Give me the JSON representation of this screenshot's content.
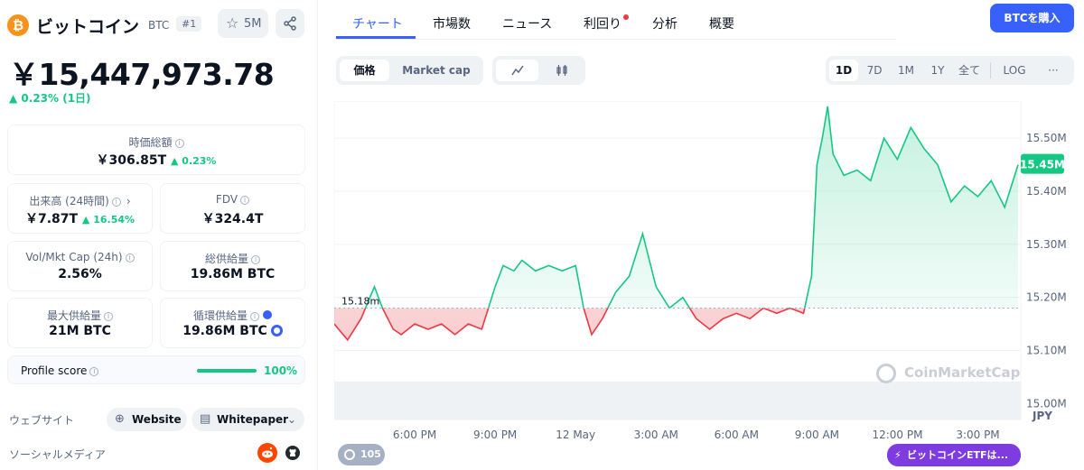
{
  "coin": {
    "logo_glyph": "₿",
    "name": "ビットコイン",
    "symbol": "BTC",
    "rank": "#1",
    "watchlist_count": "5M",
    "price": "￥15,447,973.78",
    "change": "▲ 0.23% (1日)"
  },
  "stats": {
    "market_cap": {
      "label": "時価総額",
      "value": "￥306.85T",
      "change": "▲ 0.23%"
    },
    "volume": {
      "label": "出来高 (24時間)",
      "value": "￥7.87T",
      "change": "▲ 16.54%"
    },
    "fdv": {
      "label": "FDV",
      "value": "￥324.4T"
    },
    "vol_mkt_cap": {
      "label": "Vol/Mkt Cap (24h)",
      "value": "2.56%"
    },
    "total_supply": {
      "label": "総供給量",
      "value": "19.86M BTC"
    },
    "max_supply": {
      "label": "最大供給量",
      "value": "21M BTC"
    },
    "circulating_supply": {
      "label": "循環供給量",
      "value": "19.86M BTC"
    },
    "profile_score": {
      "label": "Profile score",
      "value": "100%",
      "fraction": 1.0
    }
  },
  "links": {
    "website_label": "ウェブサイト",
    "website_button": "Website",
    "whitepaper_button": "Whitepaper",
    "social_label": "ソーシャルメディア"
  },
  "tabs": {
    "chart": "チャート",
    "markets": "市場数",
    "news": "ニュース",
    "yield": "利回り",
    "analysis": "分析",
    "overview": "概要"
  },
  "buy_button": "BTCを購入",
  "controls": {
    "price": "価格",
    "market_cap": "Market cap",
    "ranges": [
      "1D",
      "7D",
      "1M",
      "1Y",
      "全て",
      "LOG",
      "···"
    ],
    "selected_range": "1D"
  },
  "events_count": "105",
  "etf_badge": "ビットコインETFは...",
  "watermark": "CoinMarketCap",
  "colors": {
    "accent": "#3861fb",
    "up": "#16c784",
    "down": "#ea3943",
    "etf": "#7e3ce0"
  },
  "chart_data": {
    "type": "line",
    "title": "",
    "xlabel": "",
    "ylabel": "JPY",
    "unit": "JPY",
    "ylim": [
      14.97,
      15.57
    ],
    "reference_line": {
      "value": 15.18,
      "label": "15.18m"
    },
    "current_value_label": "15.45M",
    "current_value": 15.45,
    "y_ticks": [
      {
        "value": 15.5,
        "label": "15.50M"
      },
      {
        "value": 15.4,
        "label": "15.40M"
      },
      {
        "value": 15.3,
        "label": "15.30M"
      },
      {
        "value": 15.2,
        "label": "15.20M"
      },
      {
        "value": 15.1,
        "label": "15.10M"
      },
      {
        "value": 15.0,
        "label": "15.00M"
      }
    ],
    "x_ticks": [
      {
        "label": "6:00 PM",
        "x": 3
      },
      {
        "label": "9:00 PM",
        "x": 6
      },
      {
        "label": "12 May",
        "x": 9
      },
      {
        "label": "3:00 AM",
        "x": 12
      },
      {
        "label": "6:00 AM",
        "x": 15
      },
      {
        "label": "9:00 AM",
        "x": 18
      },
      {
        "label": "12:00 PM",
        "x": 21
      },
      {
        "label": "3:00 PM",
        "x": 24
      }
    ],
    "x_unit": "hours from start",
    "series": [
      {
        "x": [
          0,
          0.5,
          1.0,
          1.5,
          1.8,
          2.2,
          2.5,
          3.0,
          3.5,
          4.0,
          4.5,
          5.0,
          5.5,
          6.0,
          6.3,
          6.7,
          7.0,
          7.5,
          8.0,
          8.5,
          9.0,
          9.3,
          9.6,
          10.0,
          10.5,
          11.0,
          11.5,
          12.0,
          12.5,
          13.0,
          13.5,
          14.0,
          14.5,
          15.0,
          15.5,
          16.0,
          16.5,
          17.0,
          17.5,
          17.8,
          18.0,
          18.2,
          18.4,
          18.6,
          19.0,
          19.5,
          20.0,
          20.5,
          21.0,
          21.5,
          22.0,
          22.5,
          23.0,
          23.5,
          24.0,
          24.5,
          25.0,
          25.5
        ],
        "y": [
          15.15,
          15.12,
          15.16,
          15.22,
          15.18,
          15.14,
          15.13,
          15.15,
          15.14,
          15.15,
          15.13,
          15.15,
          15.14,
          15.22,
          15.26,
          15.25,
          15.27,
          15.25,
          15.26,
          15.25,
          15.26,
          15.18,
          15.13,
          15.16,
          15.21,
          15.24,
          15.32,
          15.22,
          15.18,
          15.2,
          15.16,
          15.14,
          15.16,
          15.17,
          15.16,
          15.18,
          15.17,
          15.18,
          15.17,
          15.24,
          15.45,
          15.5,
          15.56,
          15.47,
          15.43,
          15.44,
          15.42,
          15.5,
          15.46,
          15.52,
          15.48,
          15.45,
          15.38,
          15.41,
          15.39,
          15.42,
          15.37,
          15.45
        ]
      }
    ]
  }
}
